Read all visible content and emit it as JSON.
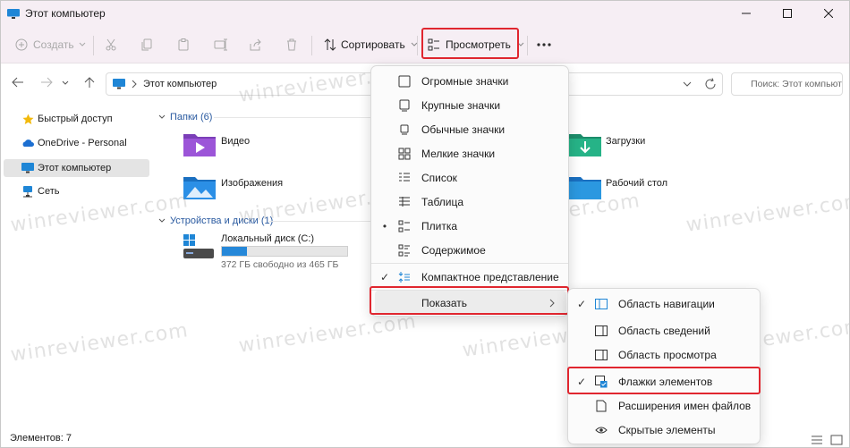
{
  "window": {
    "title": "Этот компьютер"
  },
  "toolbar": {
    "create_label": "Создать",
    "sort_label": "Сортировать",
    "view_label": "Просмотреть"
  },
  "address": {
    "location": "Этот компьютер",
    "search_placeholder": "Поиск: Этот компьют"
  },
  "sidebar": {
    "items": [
      {
        "label": "Быстрый доступ",
        "icon": "star-icon"
      },
      {
        "label": "OneDrive - Personal",
        "icon": "cloud-icon"
      },
      {
        "label": "Этот компьютер",
        "icon": "computer-icon",
        "active": true
      },
      {
        "label": "Сеть",
        "icon": "network-icon"
      }
    ]
  },
  "content": {
    "folders_header": "Папки (6)",
    "folders": [
      {
        "label": "Видео",
        "icon": "video-folder-icon"
      },
      {
        "label": "Изображения",
        "icon": "pictures-folder-icon"
      },
      {
        "label": "Загрузки",
        "icon": "downloads-folder-icon"
      },
      {
        "label": "Рабочий стол",
        "icon": "desktop-folder-icon"
      }
    ],
    "drives_header": "Устройства и диски (1)",
    "drive": {
      "name": "Локальный диск (C:)",
      "free_text": "372 ГБ свободно из 465 ГБ",
      "used_fraction": 0.2
    }
  },
  "status": {
    "items_text": "Элементов: 7"
  },
  "view_menu": {
    "items": [
      {
        "label": "Огромные значки",
        "icon": "huge-icons-icon"
      },
      {
        "label": "Крупные значки",
        "icon": "large-icons-icon"
      },
      {
        "label": "Обычные значки",
        "icon": "medium-icons-icon"
      },
      {
        "label": "Мелкие значки",
        "icon": "small-icons-icon"
      },
      {
        "label": "Список",
        "icon": "list-icon"
      },
      {
        "label": "Таблица",
        "icon": "details-icon"
      },
      {
        "label": "Плитка",
        "icon": "tiles-icon",
        "marker": "•"
      },
      {
        "label": "Содержимое",
        "icon": "content-icon"
      },
      {
        "label": "Компактное представление",
        "icon": "compact-icon",
        "marker": "✓"
      },
      {
        "label": "Показать",
        "submenu": true
      }
    ]
  },
  "show_menu": {
    "items": [
      {
        "label": "Область навигации",
        "icon": "nav-pane-icon",
        "checked": "✓"
      },
      {
        "label": "Область сведений",
        "icon": "details-pane-icon"
      },
      {
        "label": "Область просмотра",
        "icon": "preview-pane-icon"
      },
      {
        "label": "Флажки элементов",
        "icon": "item-checkbox-icon",
        "checked": "✓"
      },
      {
        "label": "Расширения имен файлов",
        "icon": "file-ext-icon"
      },
      {
        "label": "Скрытые элементы",
        "icon": "hidden-items-icon"
      }
    ]
  },
  "watermark": "winreviewer.com",
  "colors": {
    "accent": "#2688d9",
    "highlight": "#e0262f",
    "titlebar": "#f6eef4"
  }
}
